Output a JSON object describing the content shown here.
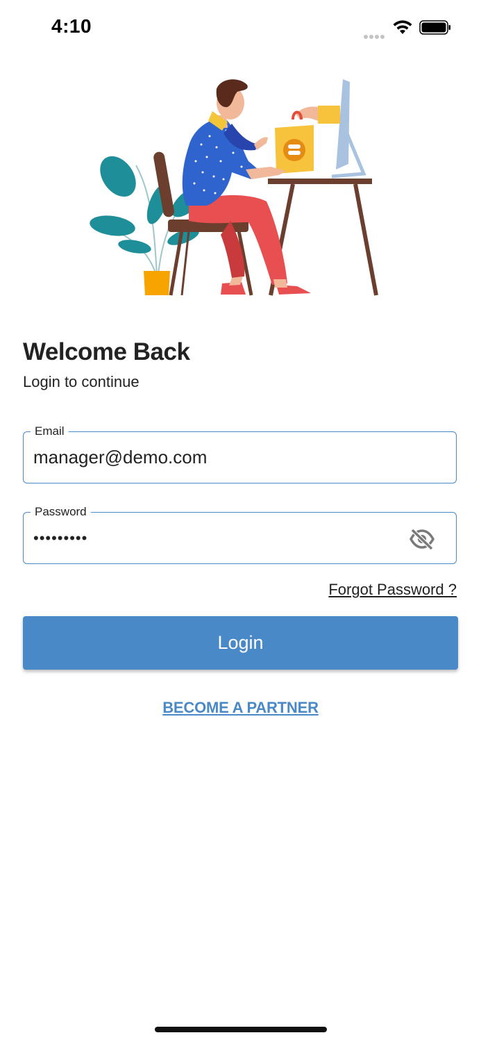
{
  "status_bar": {
    "time": "4:10",
    "icons": [
      "signal-icon",
      "wifi-icon",
      "battery-icon"
    ]
  },
  "illustration": {
    "icon": "person-ordering-food-illustration"
  },
  "heading": {
    "title": "Welcome Back",
    "subtitle": "Login to continue"
  },
  "form": {
    "email": {
      "label": "Email",
      "value": "manager@demo.com"
    },
    "password": {
      "label": "Password",
      "value": "•••••••••",
      "toggle_icon": "eye-off-icon"
    },
    "forgot_password": "Forgot Password ?",
    "login_button": "Login",
    "partner_link": "BECOME A PARTNER"
  },
  "colors": {
    "accent": "#4a89c8",
    "field_border": "#4a88c7",
    "text": "#222222"
  }
}
